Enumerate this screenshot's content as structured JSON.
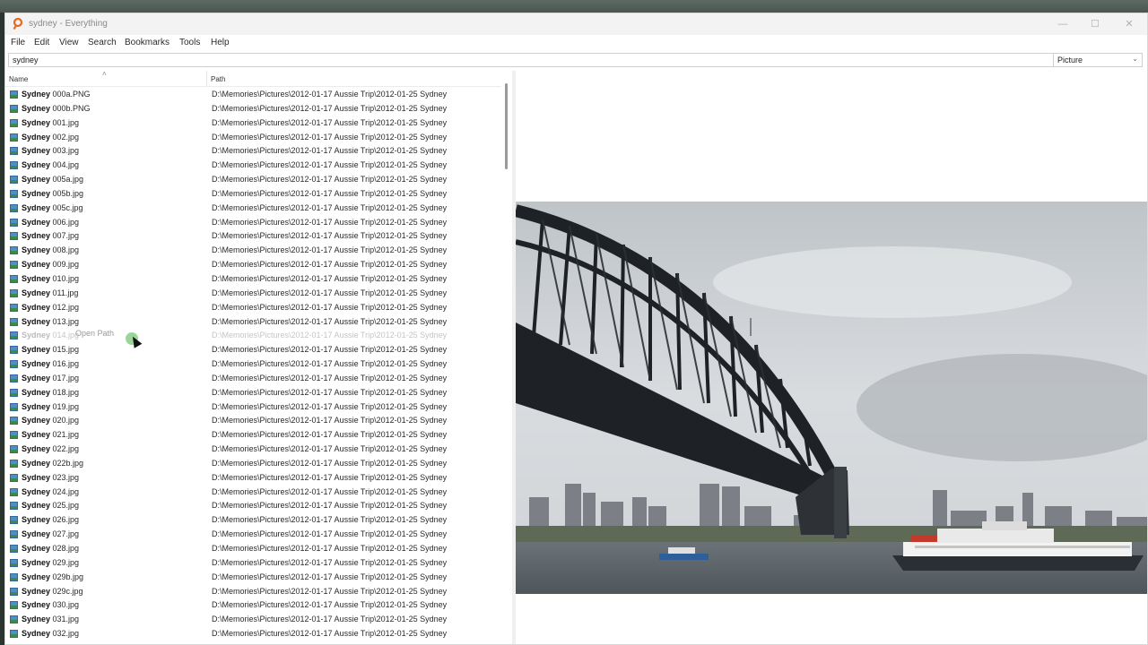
{
  "window": {
    "title": "sydney - Everything"
  },
  "menu": [
    "File",
    "Edit",
    "View",
    "Search",
    "Bookmarks",
    "Tools",
    "Help"
  ],
  "search": {
    "value": "sydney"
  },
  "filter": {
    "selected": "Picture"
  },
  "columns": {
    "name": "Name",
    "path": "Path"
  },
  "drag": {
    "tooltip": "Open Path"
  },
  "results": {
    "highlight": "Sydney",
    "path": "D:\\Memories\\Pictures\\2012-01-17 Aussie Trip\\2012-01-25 Sydney",
    "rows": [
      " 000a.PNG",
      " 000b.PNG",
      " 001.jpg",
      " 002.jpg",
      " 003.jpg",
      " 004.jpg",
      " 005a.jpg",
      " 005b.jpg",
      " 005c.jpg",
      " 006.jpg",
      " 007.jpg",
      " 008.jpg",
      " 009.jpg",
      " 010.jpg",
      " 011.jpg",
      " 012.jpg",
      " 013.jpg",
      " 014.jpg",
      " 015.jpg",
      " 016.jpg",
      " 017.jpg",
      " 018.jpg",
      " 019.jpg",
      " 020.jpg",
      " 021.jpg",
      " 022.jpg",
      " 022b.jpg",
      " 023.jpg",
      " 024.jpg",
      " 025.jpg",
      " 026.jpg",
      " 027.jpg",
      " 028.jpg",
      " 029.jpg",
      " 029b.jpg",
      " 029c.jpg",
      " 030.jpg",
      " 031.jpg",
      " 032.jpg"
    ]
  },
  "colors": {
    "accent": "#d9531e",
    "selection": "#cce8ff"
  }
}
